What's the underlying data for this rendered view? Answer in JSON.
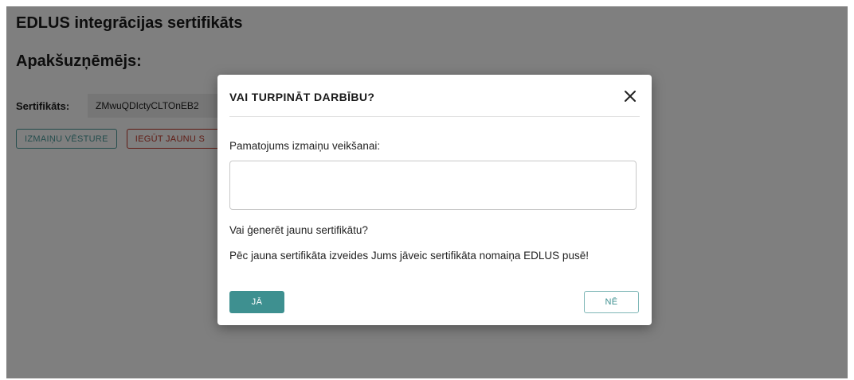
{
  "page": {
    "title": "EDLUS integrācijas sertifikāts",
    "subtitle": "Apakšuzņēmējs:"
  },
  "certificate": {
    "label": "Sertifikāts:",
    "value": "ZMwuQDIctyCLTOnEB2"
  },
  "actions": {
    "history_label": "IZMAIŅU VĒSTURE",
    "get_new_label": "IEGŪT JAUNU S"
  },
  "dialog": {
    "title": "VAI TURPINĀT DARBĪBU?",
    "close_icon": "close-icon",
    "reason_label": "Pamatojums izmaiņu veikšanai:",
    "reason_value": "",
    "question": "Vai ģenerēt jaunu sertifikātu?",
    "info": "Pēc jauna sertifikāta izveides Jums jāveic sertifikāta nomaiņa EDLUS pusē!",
    "yes_label": "JĀ",
    "no_label": "NĒ"
  },
  "colors": {
    "accent": "#3e9090",
    "danger": "#c0392b",
    "overlay": "rgba(0,0,0,0.5)"
  }
}
